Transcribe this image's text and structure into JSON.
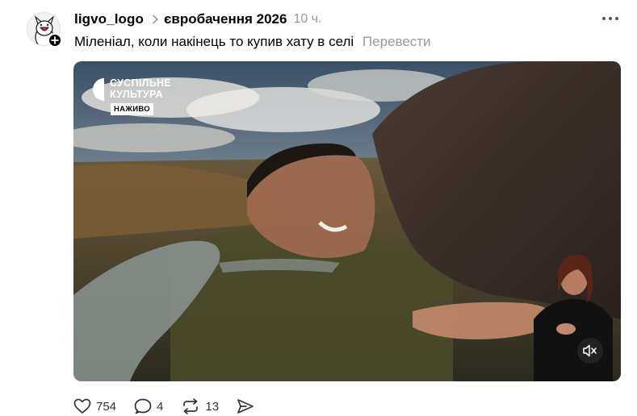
{
  "post": {
    "username": "ligvo_logo",
    "community": "євробачення 2026",
    "time": "10 ч.",
    "text": "Міленіал, коли накінець то купив хату в селі",
    "translate_label": "Перевести"
  },
  "media": {
    "channel_logo_line1": "СУСПІЛЬНЕ",
    "channel_logo_line2": "КУЛЬТУРА",
    "live_badge": "НАЖИВО"
  },
  "actions": {
    "likes": "754",
    "comments": "4",
    "reposts": "13"
  },
  "icons": {
    "more": "more-dots-icon",
    "like": "heart-icon",
    "comment": "comment-bubble-icon",
    "repost": "repost-icon",
    "share": "share-send-icon",
    "mute": "speaker-muted-icon"
  },
  "colors": {
    "secondary_text": "#999999",
    "primary_text": "#000000"
  }
}
